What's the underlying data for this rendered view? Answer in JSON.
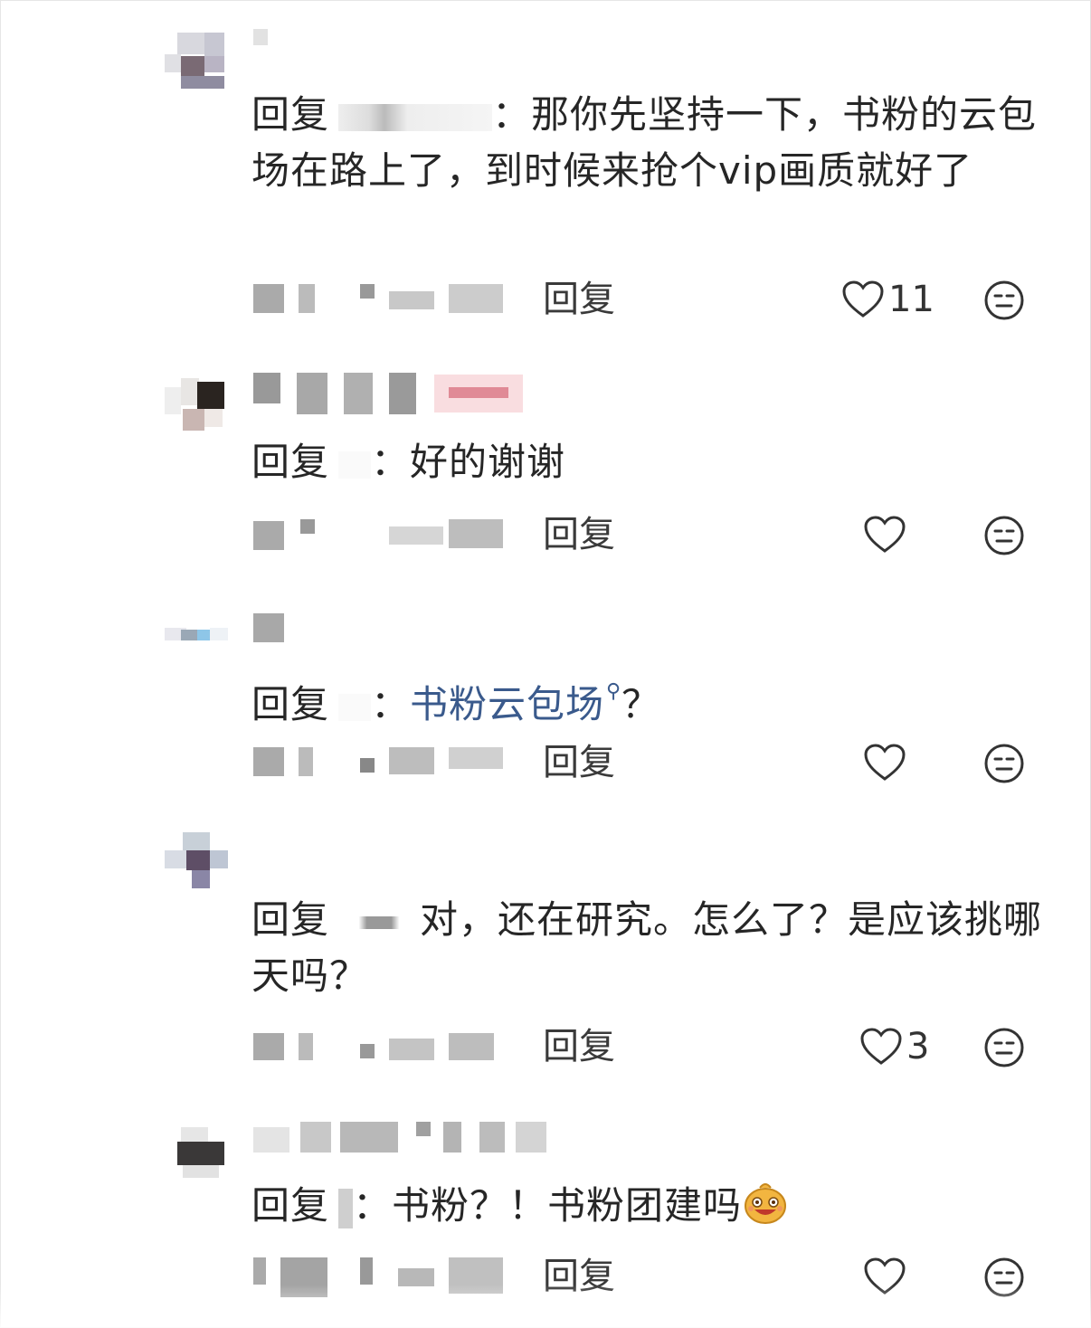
{
  "comments": [
    {
      "reply_prefix": "回复",
      "separator": "：",
      "text": "那你先坚持一下，书粉的云包场在路上了，到时候来抢个vip画质就好了",
      "reply_label": "回复",
      "like_count": "11"
    },
    {
      "reply_prefix": "回复",
      "separator": "：",
      "text": "好的谢谢",
      "reply_label": "回复",
      "like_count": ""
    },
    {
      "reply_prefix": "回复",
      "separator": "：",
      "link_text": "书粉云包场",
      "text_after": "？",
      "reply_label": "回复",
      "like_count": ""
    },
    {
      "reply_prefix": "回复",
      "text": "对，还在研究。怎么了？是应该挑哪天吗？",
      "reply_label": "回复",
      "like_count": "3"
    },
    {
      "reply_prefix": "回复",
      "separator": "：",
      "text": "书粉？！书粉团建吗",
      "reply_label": "回复",
      "like_count": ""
    }
  ],
  "icons": {
    "like": "heart-outline-icon",
    "dislike": "dislike-face-icon",
    "link": "search-icon",
    "emoji": "grin-emoji"
  },
  "colors": {
    "link": "#3a5a8c",
    "text": "#262626"
  }
}
